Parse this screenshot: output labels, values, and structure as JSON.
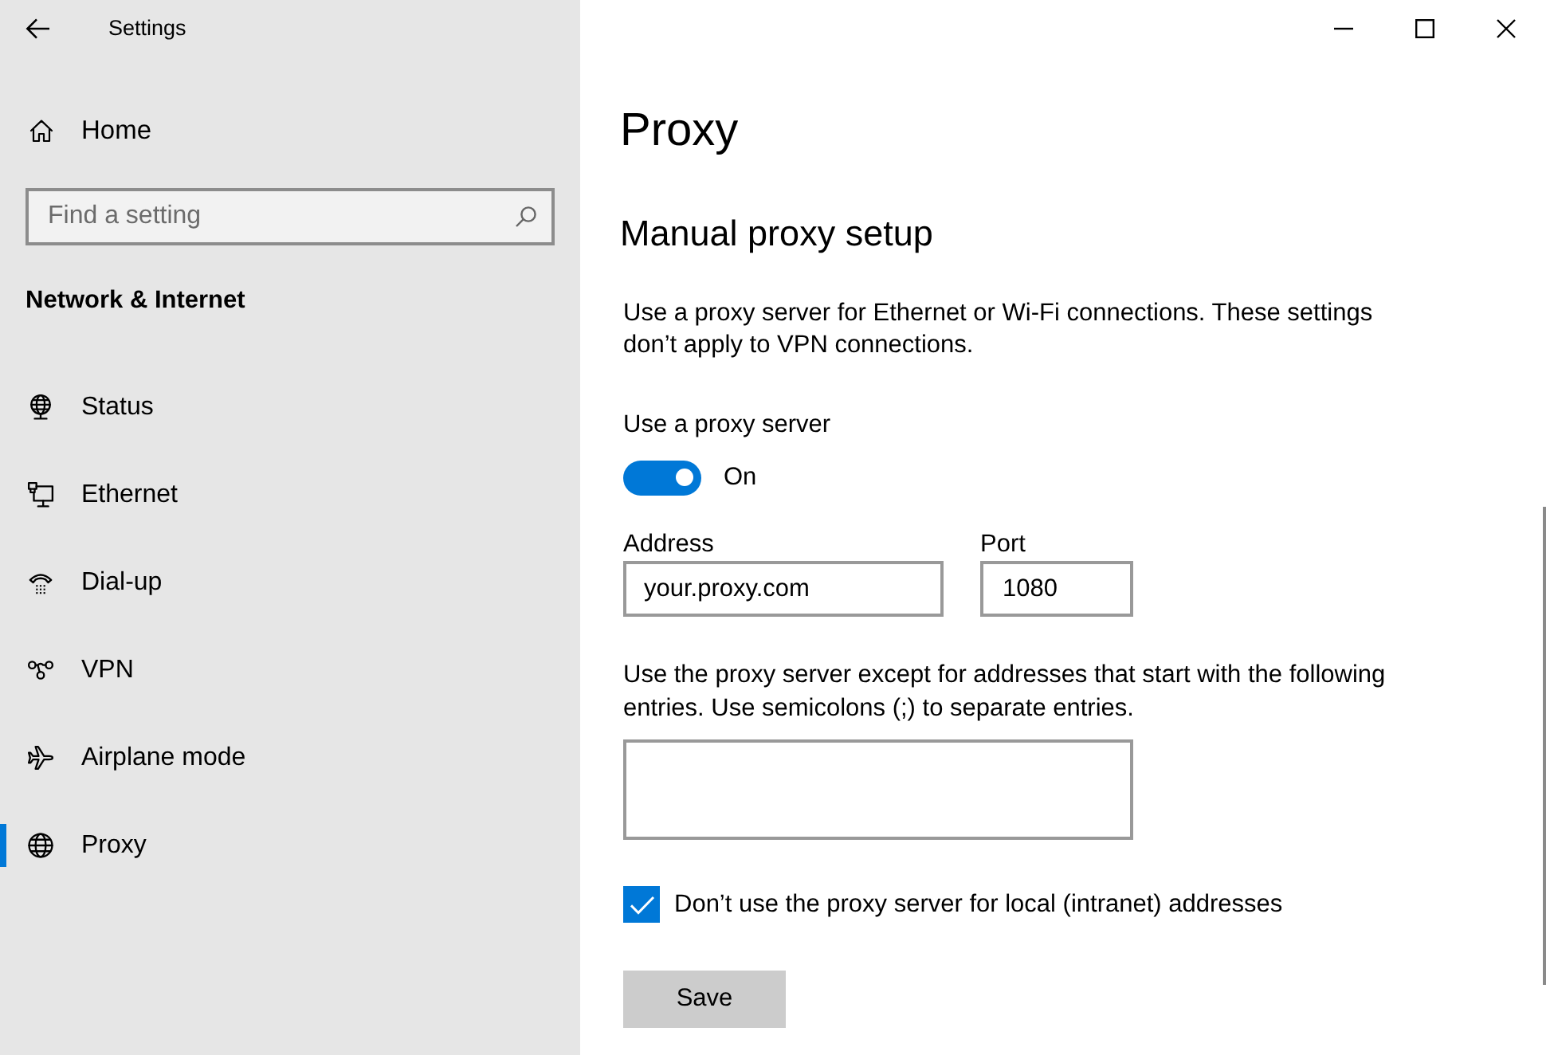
{
  "window": {
    "title": "Settings"
  },
  "sidebar": {
    "home": "Home",
    "search": {
      "placeholder": "Find a setting"
    },
    "section_title": "Network & Internet",
    "items": [
      {
        "label": "Status",
        "selected": false
      },
      {
        "label": "Ethernet",
        "selected": false
      },
      {
        "label": "Dial-up",
        "selected": false
      },
      {
        "label": "VPN",
        "selected": false
      },
      {
        "label": "Airplane mode",
        "selected": false
      },
      {
        "label": "Proxy",
        "selected": true
      }
    ]
  },
  "page": {
    "title": "Proxy",
    "section_title": "Manual proxy setup",
    "description": "Use a proxy server for Ethernet or Wi-Fi connections. These settings don’t apply to VPN connections.",
    "proxy_toggle": {
      "label": "Use a proxy server",
      "on": true,
      "state_text": "On"
    },
    "address": {
      "label": "Address",
      "value": "your.proxy.com"
    },
    "port": {
      "label": "Port",
      "value": "1080"
    },
    "exceptions": {
      "label": "Use the proxy server except for addresses that start with the following entries. Use semicolons (;) to separate entries."
    },
    "bypass_local": {
      "label": "Don’t use the proxy server for local (intranet) addresses",
      "checked": true
    },
    "save_button": "Save"
  }
}
